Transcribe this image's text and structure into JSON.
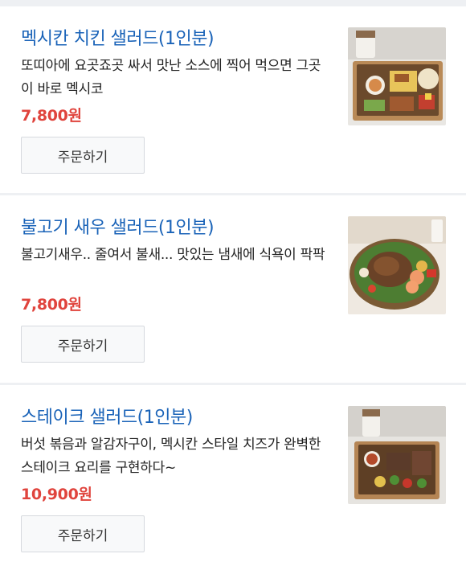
{
  "menu": {
    "items": [
      {
        "name": "멕시칸 치킨 샐러드(1인분)",
        "description": "또띠아에 요곳죠곳 싸서 맛난 소스에 찍어 먹으면 그곳이 바로 멕시코",
        "price": "7,800원",
        "order_label": "주문하기",
        "image": "mexican-chicken-salad-photo"
      },
      {
        "name": "불고기 새우 샐러드(1인분)",
        "description": "불고기새우.. 줄여서 불새... 맛있는 냄새에 식욕이 팍팍",
        "price": "7,800원",
        "order_label": "주문하기",
        "image": "bulgogi-shrimp-salad-photo"
      },
      {
        "name": "스테이크 샐러드(1인분)",
        "description": "버섯 볶음과 알감자구이, 멕시칸 스타일 치즈가 완벽한 스테이크 요리를 구현하다~",
        "price": "10,900원",
        "order_label": "주문하기",
        "image": "steak-salad-photo"
      }
    ]
  }
}
